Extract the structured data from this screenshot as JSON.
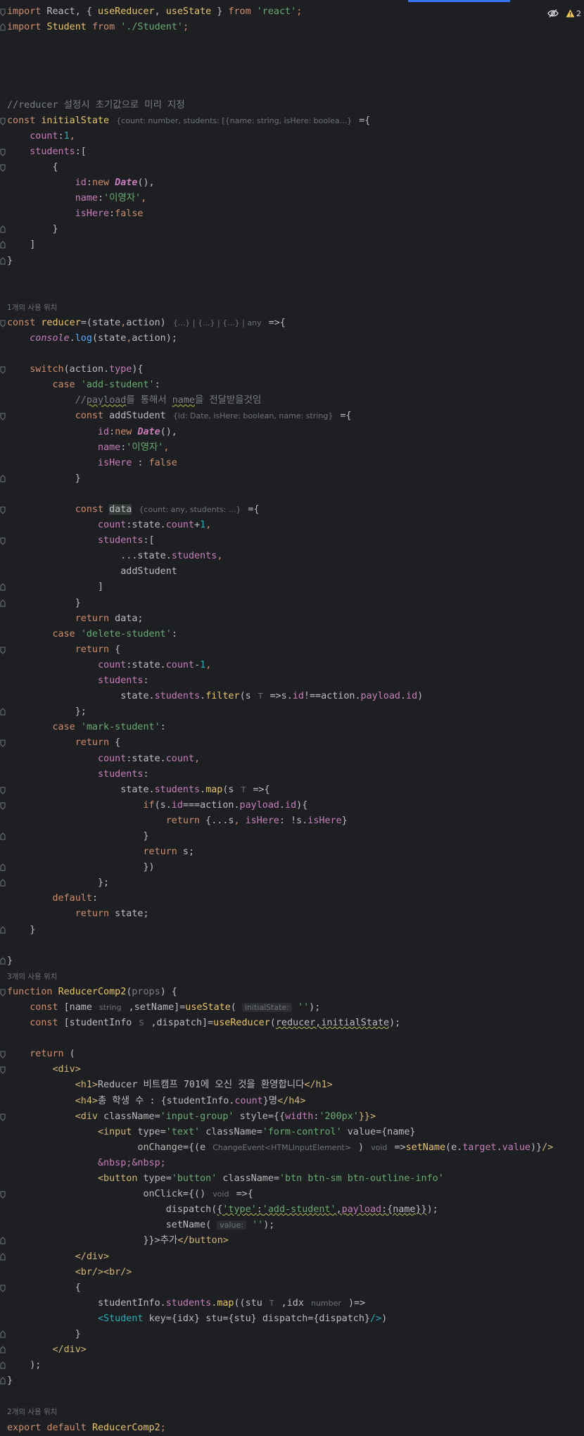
{
  "status": {
    "warning_count": "2"
  },
  "colors": {
    "background": "#1e1f22",
    "keyword": "#cf8e6d",
    "string": "#6aab73",
    "number": "#2aacb8",
    "property": "#c77dbb",
    "function": "#56a8f5",
    "tag": "#d5b778",
    "comment": "#7a7e85",
    "accent": "#3574f0"
  },
  "icons": [
    "eye-crossed-icon",
    "warning-icon",
    "fold-arrow-icon"
  ],
  "code": {
    "l1": [
      "import",
      " React, { ",
      "useReducer",
      ", ",
      "useState",
      " } ",
      "from",
      " ",
      "'react'",
      ";"
    ],
    "l2": [
      "import",
      " ",
      "Student",
      " ",
      "from",
      " ",
      "'./Student'",
      ";"
    ],
    "l7": "//reducer 설정시 초기값으로 미리 지정",
    "l8": [
      "const",
      " ",
      "initialState",
      " ",
      "{count: number, students: [{name: string, isHere: boolea...}",
      " ={"
    ],
    "l9": [
      "count",
      ":",
      "1",
      ","
    ],
    "l10": [
      "students",
      ":["
    ],
    "l11": "{",
    "l12": [
      "id",
      ":",
      "new",
      " ",
      "Date",
      "(),"
    ],
    "l13": [
      "name",
      ":",
      "'이영자'",
      ","
    ],
    "l14": [
      "isHere",
      ":",
      "false"
    ],
    "l15": "}",
    "l16": "]",
    "l17": "}",
    "hint1": "1개의 사용 위치",
    "l20": [
      "const",
      " ",
      "reducer",
      "=(state",
      ",",
      "action) ",
      "{...} | {...} | {...} | any",
      " =>{"
    ],
    "l21": [
      "console",
      ".",
      "log",
      "(state",
      ",",
      "action);"
    ],
    "l23": [
      "switch",
      "(action.",
      "type",
      "){"
    ],
    "l24": [
      "case",
      " ",
      "'add-student'",
      ":"
    ],
    "l25": [
      "//",
      "payload",
      "를 통해서 ",
      "name",
      "을 전달받을것임"
    ],
    "l26": [
      "const",
      " addStudent ",
      "{id: Date, isHere: boolean, name: string}",
      " ={"
    ],
    "l27": [
      "id",
      ":",
      "new",
      " ",
      "Date",
      "(),"
    ],
    "l28": [
      "name",
      ":",
      "'이영자'",
      ","
    ],
    "l29": [
      "isHere",
      " : ",
      "false"
    ],
    "l30": "}",
    "l32": [
      "const",
      " ",
      "data",
      " ",
      "{count: any, students: ...}",
      " ={"
    ],
    "l33": [
      "count",
      ":state.",
      "count",
      "+",
      "1",
      ","
    ],
    "l34": [
      "students",
      ":["
    ],
    "l35": [
      "...state.",
      "students",
      ","
    ],
    "l36": "addStudent",
    "l37": "]",
    "l38": "}",
    "l39": [
      "return",
      " data;"
    ],
    "l40": [
      "case",
      " ",
      "'delete-student'",
      ":"
    ],
    "l41": [
      "return",
      " {"
    ],
    "l42": [
      "count",
      ":state.",
      "count",
      "-",
      "1",
      ","
    ],
    "l43": [
      "students",
      ":"
    ],
    "l44": [
      "state.",
      "students",
      ".",
      "filter",
      "(s ",
      "T",
      " =>s.",
      "id",
      "!==action.",
      "payload",
      ".",
      "id",
      ")"
    ],
    "l45": "};",
    "l46": [
      "case",
      " ",
      "'mark-student'",
      ":"
    ],
    "l47": [
      "return",
      " {"
    ],
    "l48": [
      "count",
      ":state.",
      "count",
      ","
    ],
    "l49": [
      "students",
      ":"
    ],
    "l50": [
      "state.",
      "students",
      ".",
      "map",
      "(s ",
      "T",
      " =>{"
    ],
    "l51": [
      "if",
      "(s.",
      "id",
      "===action.",
      "payload",
      ".",
      "id",
      "){"
    ],
    "l52": [
      "return",
      " {...s",
      ", ",
      "isHere",
      ": !s.",
      "isHere",
      "}"
    ],
    "l53": "}",
    "l54": [
      "return",
      " s;"
    ],
    "l55": "})",
    "l56": "};",
    "l57": [
      "default",
      ":"
    ],
    "l58": [
      "return",
      " state;"
    ],
    "l59": "}",
    "l61": "}",
    "hint2": "3개의 사용 위치",
    "l62": [
      "function",
      " ",
      "ReducerComp2",
      "(",
      "props",
      ") {"
    ],
    "l63": [
      "const",
      " [name ",
      "string",
      " ,setName]=",
      "useState",
      "( ",
      "initialState:",
      " ",
      "''",
      ");"
    ],
    "l64": [
      "const",
      " [studentInfo ",
      "S",
      " ,dispatch]=",
      "useReducer",
      "(",
      "reducer",
      ",",
      "initialState",
      ");"
    ],
    "l66": [
      "return",
      " ("
    ],
    "l67": "<div>",
    "l68": [
      "<h1>",
      "Reducer 비트캠프 701에 오신 것을 환영합니다",
      "</h1>"
    ],
    "l69": [
      "<h4>",
      "총 학생 수 : {studentInfo.",
      "count",
      "}명",
      "</h4>"
    ],
    "l70": [
      "<div",
      " ",
      "className",
      "=",
      "'input-group'",
      " ",
      "style",
      "={{",
      "width",
      ":",
      "'200px'",
      "}}>"
    ],
    "l71": [
      "<input",
      " ",
      "type",
      "=",
      "'text'",
      " ",
      "className",
      "=",
      "'form-control'",
      " ",
      "value",
      "={name}"
    ],
    "l72": [
      "onChange",
      "={(e ",
      "ChangeEvent<HTMLInputElement>",
      " ) ",
      "void",
      " =>",
      "setName",
      "(e.",
      "target",
      ".",
      "value",
      ")}",
      "/>"
    ],
    "l73": "&nbsp;&nbsp;",
    "l74": [
      "<button",
      " ",
      "type",
      "=",
      "'button'",
      " ",
      "className",
      "=",
      "'btn btn-sm btn-outline-info'"
    ],
    "l75": [
      "onClick",
      "={() ",
      "void",
      " =>{"
    ],
    "l76": [
      "dispatch",
      "(",
      "{",
      "'type'",
      ":",
      "'add-student'",
      ",",
      "payload",
      ":{name}",
      "}",
      ");"
    ],
    "l77": [
      "setName",
      "( ",
      "value:",
      " ",
      "''",
      ");"
    ],
    "l78": [
      "}}>",
      "추가",
      "</button>"
    ],
    "l79": "</div>",
    "l80": [
      "<br/>",
      "<br/>"
    ],
    "l81": "{",
    "l82": [
      "studentInfo.",
      "students",
      ".",
      "map",
      "((stu ",
      "T",
      " ,idx ",
      "number",
      " )=>"
    ],
    "l83": [
      "<Student",
      " ",
      "key",
      "={idx} ",
      "stu",
      "={stu} ",
      "dispatch",
      "={dispatch}",
      "/>",
      ")"
    ],
    "l84": "}",
    "l85": "</div>",
    "l86": ");",
    "l87": "}",
    "hint3": "2개의 사용 위치",
    "l89": [
      "export",
      " ",
      "default",
      " ",
      "ReducerComp2",
      ";"
    ]
  }
}
